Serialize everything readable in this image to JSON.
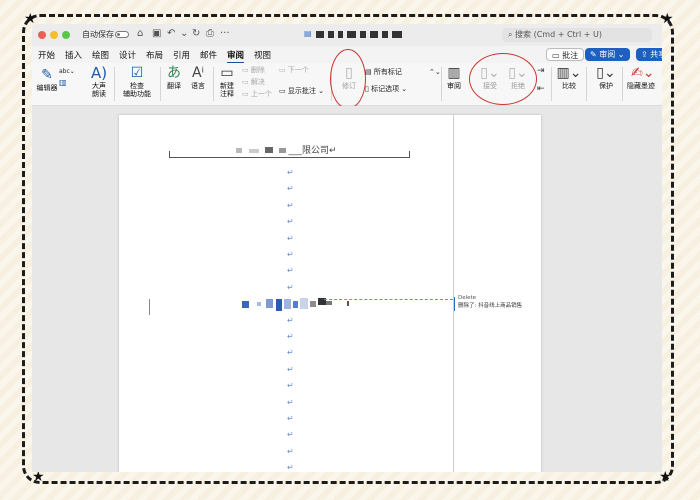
{
  "titlebar": {
    "autosave_label": "自动保存",
    "search_placeholder": "搜索 (Cmd + Ctrl + U)",
    "traffic_colors": [
      "#ee5e57",
      "#f5bd32",
      "#5bc646"
    ]
  },
  "menu": {
    "tabs": [
      "开始",
      "插入",
      "绘图",
      "设计",
      "布局",
      "引用",
      "邮件",
      "审阅",
      "视图"
    ],
    "active_tab": "审阅",
    "comment_button": "批注",
    "review_button": "审阅",
    "share_button": "共享"
  },
  "ribbon": {
    "editor": "编辑器",
    "read_aloud_line1": "大声",
    "read_aloud_line2": "朗读",
    "check_line1": "检查",
    "check_line2": "辅助功能",
    "translate": "翻译",
    "language": "语言",
    "new_comment_line1": "新建",
    "new_comment_line2": "注释",
    "delete": "删除",
    "resolve": "解决",
    "previous": "上一个",
    "next": "下一个",
    "show_comments": "显示批注",
    "track_changes": "修订",
    "all_markup": "所有标记",
    "markup_options": "标记选项",
    "reviewing_pane": "审阅",
    "accept": "接受",
    "reject": "拒绝",
    "compare": "比较",
    "protect": "保护",
    "hide_ink": "隐藏墨迹"
  },
  "document": {
    "header": "___限公司",
    "paragraph_mark": "↵",
    "comment_author": "Delete",
    "comment_text": "删除了: 抖音线上商品销售"
  },
  "colors": {
    "accent": "#1f5fbf",
    "annotation_red": "#c8362e",
    "paragraph_mark": "#6a8fc7"
  }
}
